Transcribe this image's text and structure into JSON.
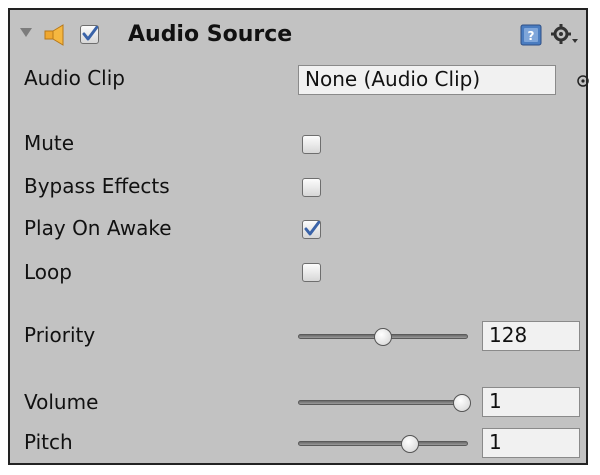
{
  "component": {
    "title": "Audio Source",
    "enabled": true,
    "icons": {
      "foldout": "foldout-arrow-icon",
      "type": "speaker-icon",
      "help": "help-icon",
      "settings": "gear-icon"
    }
  },
  "fields": {
    "audio_clip": {
      "label": "Audio Clip",
      "value": "None (Audio Clip)"
    },
    "mute": {
      "label": "Mute",
      "checked": false
    },
    "bypass_effects": {
      "label": "Bypass Effects",
      "checked": false
    },
    "play_on_awake": {
      "label": "Play On Awake",
      "checked": true
    },
    "loop": {
      "label": "Loop",
      "checked": false
    },
    "priority": {
      "label": "Priority",
      "value": "128",
      "level": 0.5
    },
    "volume": {
      "label": "Volume",
      "value": "1",
      "level": 1.0
    },
    "pitch": {
      "label": "Pitch",
      "value": "1",
      "level": 0.67
    }
  },
  "colors": {
    "panel_bg": "#c2c2c2",
    "speaker": "#f0a830",
    "checkmark": "#3a63a8",
    "help": "#4a7cc0"
  }
}
